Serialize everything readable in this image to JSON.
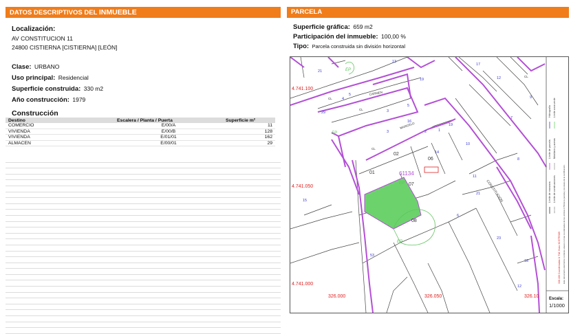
{
  "left": {
    "header_a": "DATOS DESCRIPTIVOS DEL ",
    "header_b": "INMUEBLE",
    "loc_label": "Localización:",
    "address1": "AV CONSTITUCION 11",
    "address2": "24800 CISTIERNA [CISTIERNA] [LEÓN]",
    "clase_label": "Clase:",
    "clase_value": "URBANO",
    "uso_label": "Uso principal:",
    "uso_value": "Residencial",
    "sup_label": "Superficie construida:",
    "sup_value": "330 m2",
    "ano_label": "Año construcción:",
    "ano_value": "1979",
    "construccion_title": "Construcción",
    "table": {
      "headers": [
        "Destino",
        "Escalera / Planta / Puerta",
        "Superficie m²"
      ],
      "rows": [
        [
          "COMERCIO",
          "E/00/A",
          "11"
        ],
        [
          "VIVIENDA",
          "E/00/B",
          "128"
        ],
        [
          "VIVIENDA",
          "E/01/01",
          "162"
        ],
        [
          "ALMACEN",
          "E/00/01",
          "29"
        ]
      ]
    }
  },
  "right": {
    "header": "PARCELA",
    "sup_grafica_label": "Superficie gráfica:",
    "sup_grafica_value": "659 m2",
    "participacion_label": "Participación del inmueble:",
    "participacion_value": "100,00 %",
    "tipo_label": "Tipo:",
    "tipo_value": "Parcela construida sin división horizontal",
    "map": {
      "coord_y_top": "4.741.100",
      "coord_y_mid": "4.741.050",
      "coord_y_bot": "4.741.000",
      "coord_x1": "326.000",
      "coord_x2": "326.050",
      "coord_x3": "326.10",
      "street_carmen": "CARMEN",
      "street_marcelo": "MARCELO",
      "street_constitucion": "CONSTITUCION",
      "parcel_labels": [
        "01",
        "02",
        "06",
        "07",
        "08"
      ],
      "parcel_id": "61134",
      "road_numbers": [
        "21",
        "19",
        "17",
        "13",
        "10",
        "8",
        "5",
        "3",
        "4",
        "2",
        "1",
        "16",
        "14",
        "19",
        "29",
        "12",
        "11",
        "6",
        "53",
        "23",
        "21",
        "18",
        "15",
        "3",
        "5",
        "7",
        "9",
        "12"
      ],
      "ep_labels": [
        "EP",
        "EP",
        "EP",
        "EP"
      ],
      "cl_labels": [
        "CL",
        "CL",
        "CL",
        "CL"
      ],
      "legend": {
        "limite_manzana": "Límite de manzana",
        "limite_parcela": "Límite de parcela",
        "limite_construcciones": "Límite de construcciones",
        "mobiliario": "Mobiliario y aceras",
        "limite_zona_verde": "Límite zona verde",
        "hidrografia": "Hidrografía",
        "footnote": "Este documento electrónico contiene anexos con las coordenadas de los vértices UTM de la parcela y los datos de la certificación.",
        "footnote_red": "338.100 Coordenadas U.T.M. Huso 30 ETRS89"
      },
      "escala_label": "Escala:",
      "escala_value": "1/1000"
    }
  },
  "colors": {
    "header": "#f07d1a",
    "parcel_outline": "#b34fd6",
    "green_area": "#6cd36c",
    "coord_red": "#e02020",
    "road_blue": "#3b3bd4"
  }
}
